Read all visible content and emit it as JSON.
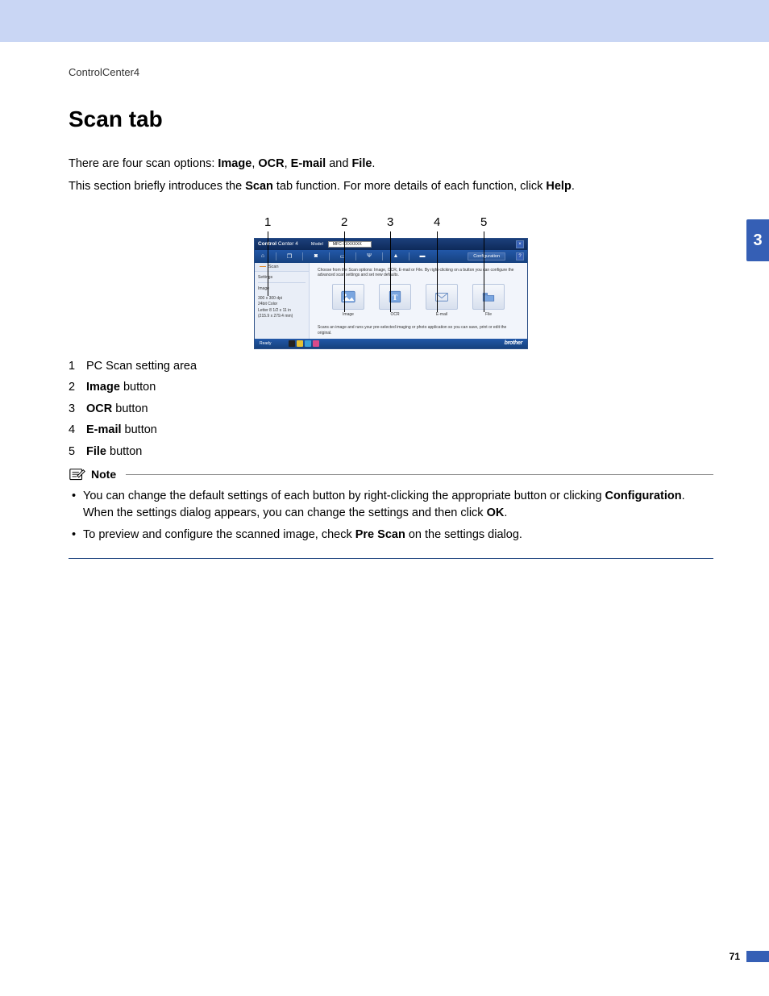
{
  "header": {
    "doc_label": "ControlCenter4"
  },
  "section_tab": "3",
  "page_number": "71",
  "title": "Scan tab",
  "intro": {
    "line1_pre": "There are four scan options: ",
    "opt1": "Image",
    "sep1": ", ",
    "opt2": "OCR",
    "sep2": ", ",
    "opt3": "E-mail",
    "sep3": " and ",
    "opt4": "File",
    "line1_post": ".",
    "line2_pre": "This section briefly introduces the ",
    "line2_bold": "Scan",
    "line2_mid": " tab function. For more details of each function, click ",
    "line2_bold2": "Help",
    "line2_post": "."
  },
  "callouts": {
    "c1": "1",
    "c2": "2",
    "c3": "3",
    "c4": "4",
    "c5": "5"
  },
  "shot": {
    "title_brand_bold": "Control",
    "title_brand_rest": " Center 4",
    "model_label": "Model",
    "model_value": "MFC-XXXXXXX",
    "close": "×",
    "cfg_label": "Configuration",
    "help": "?",
    "side_tab_scan": "Scan",
    "side_settings_title": "Settings",
    "side_setting_image": "Image",
    "side_setting_dpi": "300 x 300 dpi",
    "side_setting_color": "24bit Color",
    "side_setting_size1": "Letter 8 1/2 x 11 in",
    "side_setting_size2": "(215.9 x 279.4 mm)",
    "instr_text": "Choose from the Scan options: Image, OCR, E-mail or File. By right-clicking on a button you can configure the advanced scan settings and set new defaults.",
    "btn_image": "Image",
    "btn_ocr": "OCR",
    "btn_email": "E-mail",
    "btn_file": "File",
    "desc_text": "Scans an image and runs your pre-selected imaging or photo application so you can save, print or edit the original.",
    "status_ready": "Ready",
    "brand": "brother"
  },
  "legend": {
    "items": [
      {
        "num": "1",
        "bold": "",
        "rest": "PC Scan setting area"
      },
      {
        "num": "2",
        "bold": "Image",
        "rest": " button"
      },
      {
        "num": "3",
        "bold": "OCR",
        "rest": " button"
      },
      {
        "num": "4",
        "bold": "E-mail",
        "rest": " button"
      },
      {
        "num": "5",
        "bold": "File",
        "rest": " button"
      }
    ]
  },
  "note": {
    "label": "Note",
    "items": [
      {
        "pre": "You can change the default settings of each button by right-clicking the appropriate button or clicking ",
        "b1": "Configuration",
        "mid": ". When the settings dialog appears, you can change the settings and then click ",
        "b2": "OK",
        "post": "."
      },
      {
        "pre": "To preview and configure the scanned image, check ",
        "b1": "Pre Scan",
        "mid": " on the settings dialog.",
        "b2": "",
        "post": ""
      }
    ]
  }
}
